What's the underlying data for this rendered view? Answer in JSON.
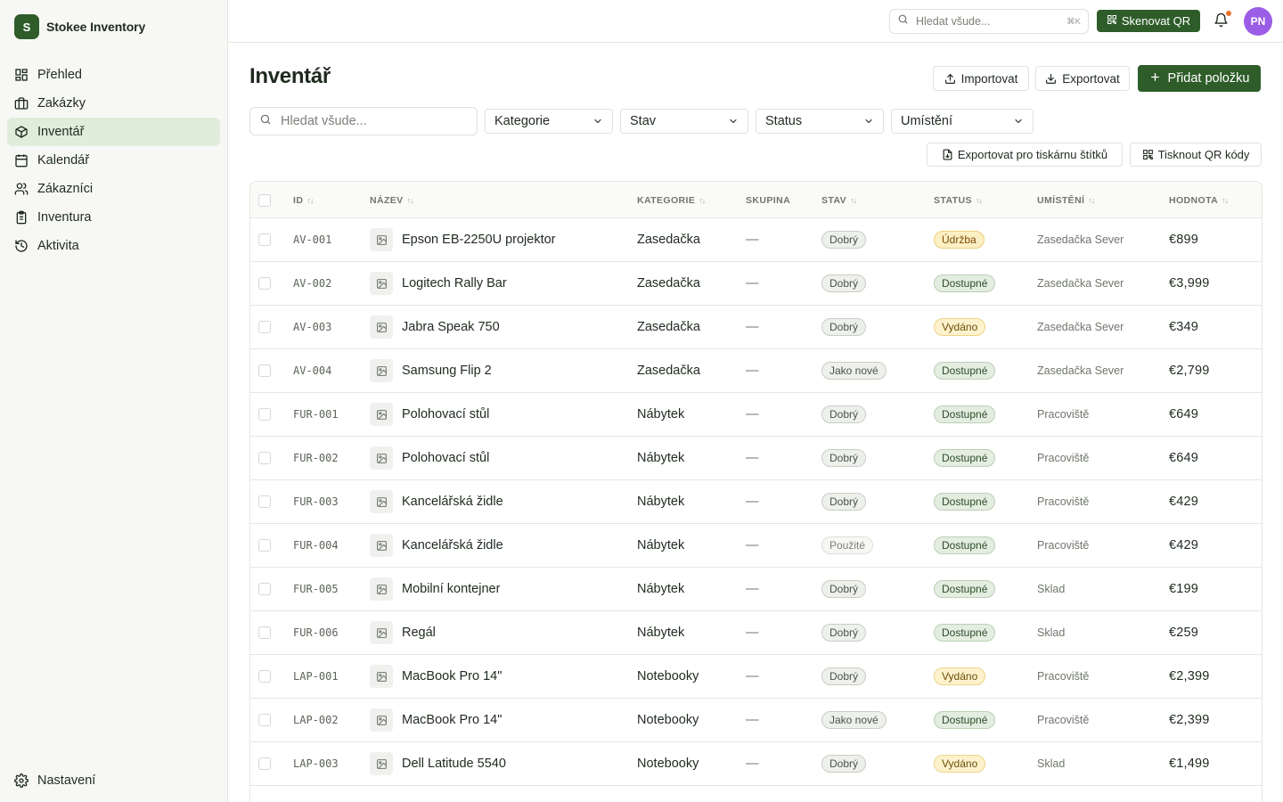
{
  "brand": {
    "logo_letter": "S",
    "name": "Stokee Inventory"
  },
  "nav": [
    {
      "label": "Přehled",
      "icon": "dashboard-icon",
      "active": false
    },
    {
      "label": "Zakázky",
      "icon": "briefcase-icon",
      "active": false
    },
    {
      "label": "Inventář",
      "icon": "box-icon",
      "active": true
    },
    {
      "label": "Kalendář",
      "icon": "calendar-icon",
      "active": false
    },
    {
      "label": "Zákazníci",
      "icon": "users-icon",
      "active": false
    },
    {
      "label": "Inventura",
      "icon": "clipboard-icon",
      "active": false
    },
    {
      "label": "Aktivita",
      "icon": "history-icon",
      "active": false
    }
  ],
  "settings": {
    "label": "Nastavení",
    "icon": "gear-icon"
  },
  "topbar": {
    "search_placeholder": "Hledat všude...",
    "shortcut": "⌘K",
    "scan_label": "Skenovat QR",
    "avatar_initials": "PN"
  },
  "page": {
    "title": "Inventář",
    "import_label": "Importovat",
    "export_label": "Exportovat",
    "add_label": "Přidat položku",
    "search_placeholder": "Hledat všude...",
    "filters": [
      "Kategorie",
      "Stav",
      "Status",
      "Umístění"
    ],
    "export_labels_label": "Exportovat pro tiskárnu štítků",
    "print_qr_label": "Tisknout QR kódy"
  },
  "table": {
    "columns": [
      "ID",
      "NÁZEV",
      "KATEGORIE",
      "SKUPINA",
      "STAV",
      "STATUS",
      "UMÍSTĚNÍ",
      "HODNOTA"
    ],
    "rows": [
      {
        "id": "AV-001",
        "name": "Epson EB-2250U projektor",
        "category": "Zasedačka",
        "group": "—",
        "condition": "Dobrý",
        "status": "Údržba",
        "location": "Zasedačka Sever",
        "value": "€899"
      },
      {
        "id": "AV-002",
        "name": "Logitech Rally Bar",
        "category": "Zasedačka",
        "group": "—",
        "condition": "Dobrý",
        "status": "Dostupné",
        "location": "Zasedačka Sever",
        "value": "€3,999"
      },
      {
        "id": "AV-003",
        "name": "Jabra Speak 750",
        "category": "Zasedačka",
        "group": "—",
        "condition": "Dobrý",
        "status": "Vydáno",
        "location": "Zasedačka Sever",
        "value": "€349"
      },
      {
        "id": "AV-004",
        "name": "Samsung Flip 2",
        "category": "Zasedačka",
        "group": "—",
        "condition": "Jako nové",
        "status": "Dostupné",
        "location": "Zasedačka Sever",
        "value": "€2,799"
      },
      {
        "id": "FUR-001",
        "name": "Polohovací stůl",
        "category": "Nábytek",
        "group": "—",
        "condition": "Dobrý",
        "status": "Dostupné",
        "location": "Pracoviště",
        "value": "€649"
      },
      {
        "id": "FUR-002",
        "name": "Polohovací stůl",
        "category": "Nábytek",
        "group": "—",
        "condition": "Dobrý",
        "status": "Dostupné",
        "location": "Pracoviště",
        "value": "€649"
      },
      {
        "id": "FUR-003",
        "name": "Kancelářská židle",
        "category": "Nábytek",
        "group": "—",
        "condition": "Dobrý",
        "status": "Dostupné",
        "location": "Pracoviště",
        "value": "€429"
      },
      {
        "id": "FUR-004",
        "name": "Kancelářská židle",
        "category": "Nábytek",
        "group": "—",
        "condition": "Použité",
        "status": "Dostupné",
        "location": "Pracoviště",
        "value": "€429"
      },
      {
        "id": "FUR-005",
        "name": "Mobilní kontejner",
        "category": "Nábytek",
        "group": "—",
        "condition": "Dobrý",
        "status": "Dostupné",
        "location": "Sklad",
        "value": "€199"
      },
      {
        "id": "FUR-006",
        "name": "Regál",
        "category": "Nábytek",
        "group": "—",
        "condition": "Dobrý",
        "status": "Dostupné",
        "location": "Sklad",
        "value": "€259"
      },
      {
        "id": "LAP-001",
        "name": "MacBook Pro 14\"",
        "category": "Notebooky",
        "group": "—",
        "condition": "Dobrý",
        "status": "Vydáno",
        "location": "Pracoviště",
        "value": "€2,399"
      },
      {
        "id": "LAP-002",
        "name": "MacBook Pro 14\"",
        "category": "Notebooky",
        "group": "—",
        "condition": "Jako nové",
        "status": "Dostupné",
        "location": "Pracoviště",
        "value": "€2,399"
      },
      {
        "id": "LAP-003",
        "name": "Dell Latitude 5540",
        "category": "Notebooky",
        "group": "—",
        "condition": "Dobrý",
        "status": "Vydáno",
        "location": "Sklad",
        "value": "€1,499"
      }
    ]
  },
  "colors": {
    "accent": "#2f5d2a",
    "active_nav": "#e1eddb",
    "badge_good_bg": "#eef0ec",
    "badge_good_border": "#c9cdc5",
    "badge_used_bg": "#f7f7f6",
    "badge_maintenance_bg": "#fcefc4",
    "badge_issued_bg": "#fdf2cc",
    "badge_available_bg": "#e3ede0"
  }
}
